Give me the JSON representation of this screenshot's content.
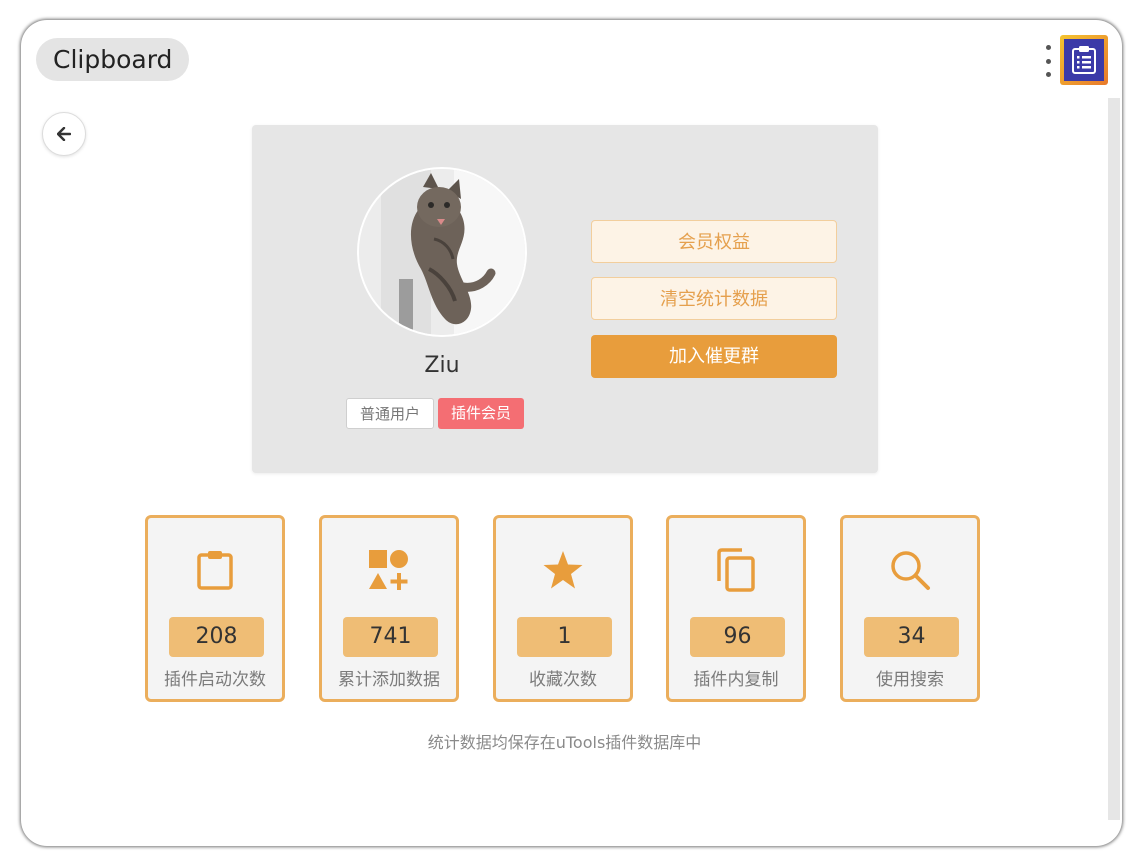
{
  "header": {
    "title": "Clipboard",
    "menu_icon": "more-vertical-icon",
    "app_icon": "clipboard-list-icon"
  },
  "navigation": {
    "back_icon": "arrow-left-icon"
  },
  "profile": {
    "username": "Ziu",
    "avatar": "cat-photo",
    "tags": [
      "普通用户",
      "插件会员"
    ],
    "buttons": {
      "benefits": "会员权益",
      "clear_stats": "清空统计数据",
      "join_group": "加入催更群"
    }
  },
  "stats": [
    {
      "icon": "clipboard-icon",
      "value": "208",
      "label": "插件启动次数"
    },
    {
      "icon": "shapes-icon",
      "value": "741",
      "label": "累计添加数据"
    },
    {
      "icon": "star-icon",
      "value": "1",
      "label": "收藏次数"
    },
    {
      "icon": "copy-icon",
      "value": "96",
      "label": "插件内复制"
    },
    {
      "icon": "search-icon",
      "value": "34",
      "label": "使用搜索"
    }
  ],
  "footnote": "统计数据均保存在uTools插件数据库中",
  "colors": {
    "accent": "#e89d3c",
    "stat_border": "#ebae5c",
    "value_bg": "#efbd75",
    "member_tag": "#f46e73",
    "card_bg": "#e6e6e6"
  }
}
